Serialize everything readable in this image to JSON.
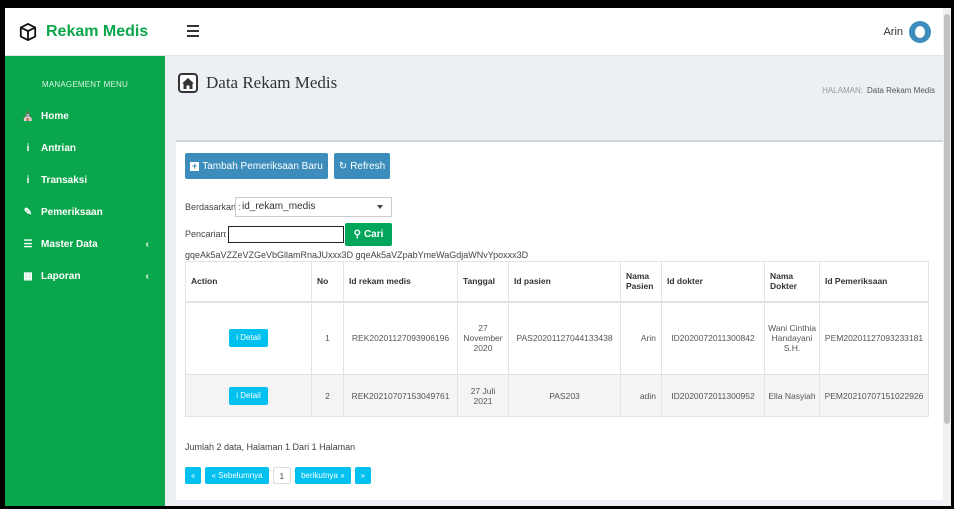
{
  "app": {
    "brand": "Rekam Medis"
  },
  "header": {
    "username": "Arin"
  },
  "sidebar": {
    "menu_header": "MANAGEMENT MENU",
    "items": [
      {
        "label": "Home",
        "icon": "home-icon"
      },
      {
        "label": "Antrian",
        "icon": "info-icon"
      },
      {
        "label": "Transaksi",
        "icon": "info-icon"
      },
      {
        "label": "Pemeriksaan",
        "icon": "edit-icon"
      },
      {
        "label": "Master Data",
        "icon": "database-icon"
      },
      {
        "label": "Laporan",
        "icon": "calendar-icon"
      }
    ],
    "caret": "‹"
  },
  "page": {
    "title": "Data Rekam Medis"
  },
  "breadcrumb": {
    "key": "HALAMAN:",
    "value": "Data Rekam Medis"
  },
  "toolbar": {
    "add_label": "Tambah Pemeriksaan Baru",
    "refresh_label": "Refresh"
  },
  "filter": {
    "by_label": "Berdasarkan :",
    "by_value": "id_rekam_medis",
    "search_label": "Pencarian",
    "search_sep": ":",
    "search_value": "",
    "search_button": "Cari",
    "token_text": "gqeAk5aVZZeVZGeVbGllamRnaJUxxx3D gqeAk5aVZpabYmeWaGdjaWNvYpoxxx3D"
  },
  "table": {
    "columns": [
      "Action",
      "No",
      "Id rekam medis",
      "Tanggal",
      "Id pasien",
      "Nama Pasien",
      "Id dokter",
      "Nama Dokter",
      "Id Pemeriksaan"
    ],
    "detail_label": "Detail",
    "rows": [
      {
        "no": "1",
        "id_rekam_medis": "REK20201127093906196",
        "tanggal": "27 November 2020",
        "id_pasien": "PAS20201127044133438",
        "nama_pasien": "Arin",
        "id_dokter": "ID2020072011300842",
        "nama_dokter": "Wani Cinthia Handayani S.H.",
        "id_pemeriksaan": "PEM20201127093233181"
      },
      {
        "no": "2",
        "id_rekam_medis": "REK20210707153049761",
        "tanggal": "27 Juli 2021",
        "id_pasien": "PAS203",
        "nama_pasien": "adin",
        "id_dokter": "ID2020072011300952",
        "nama_dokter": "Ella Nasyiah",
        "id_pemeriksaan": "PEM20210707151022926"
      }
    ]
  },
  "summary": "Jumlah 2 data, Halaman 1 Dari 1 Halaman",
  "pagination": {
    "first": "«",
    "prev": "« Sebelumnya",
    "current": "1",
    "next": "berikutnya »",
    "last": "»"
  },
  "colors": {
    "sidebar": "#0aa64b",
    "primary": "#3c8dbc",
    "success": "#00a65a",
    "info": "#00c0ef"
  }
}
